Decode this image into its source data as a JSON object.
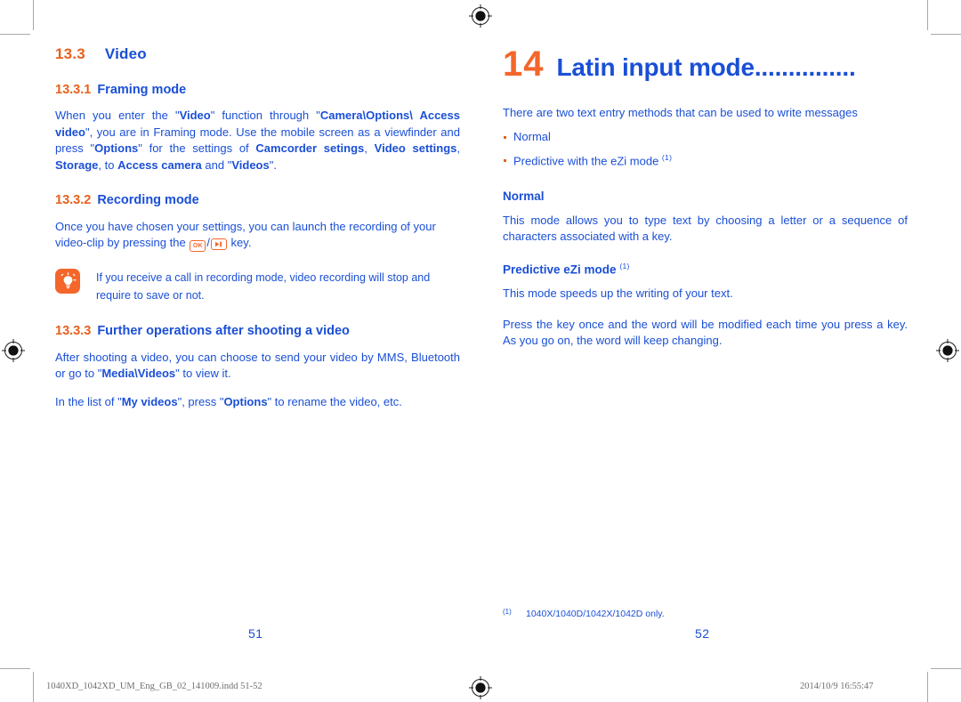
{
  "document": {
    "left_page": {
      "section": {
        "number": "13.3",
        "title": "Video"
      },
      "subsections": [
        {
          "number": "13.3.1",
          "title": "Framing mode",
          "paragraphs": [
            "When you enter the \"Video\" function through \"Camera\\Options\\ Access video\", you are in Framing mode. Use the mobile screen as a viewfinder and press \"Options\" for the settings of Camcorder setings, Video settings, Storage, to Access camera and \"Videos\"."
          ]
        },
        {
          "number": "13.3.2",
          "title": "Recording mode",
          "paragraphs": [
            "Once you have chosen your settings, you can launch the recording of your video-clip by pressing the / key."
          ],
          "tip": "If you receive a call in recording mode, video recording will stop and require to save or not.",
          "keys": {
            "ok_label": "OK",
            "separator": "/"
          }
        },
        {
          "number": "13.3.3",
          "title": "Further operations after shooting a video",
          "paragraphs": [
            "After shooting a video, you can choose to send your video by MMS, Bluetooth or go to \"Media\\Videos\" to view it.",
            "In the list of \"My videos\", press \"Options\" to rename the video, etc."
          ]
        }
      ],
      "folio": "51"
    },
    "right_page": {
      "chapter": {
        "number": "14",
        "title": "Latin input mode..............."
      },
      "intro": "There are two text entry methods that can be used to write messages",
      "bullets": [
        {
          "text": "Normal",
          "footnote": ""
        },
        {
          "text": "Predictive with the eZi mode",
          "footnote": "(1)"
        }
      ],
      "blocks": [
        {
          "heading": "Normal",
          "heading_footnote": "",
          "paragraphs": [
            "This mode allows you to type text by choosing a letter or a sequence of characters associated with a key."
          ]
        },
        {
          "heading": "Predictive eZi mode",
          "heading_footnote": "(1)",
          "paragraphs": [
            "This mode speeds up the writing of your text.",
            "Press the key once and the word will be modified each time you press a key.  As you go on, the word will keep changing."
          ]
        }
      ],
      "footnote": {
        "mark": "(1)",
        "text": "1040X/1040D/1042X/1042D only."
      },
      "folio": "52"
    },
    "print_footer": {
      "file": "1040XD_1042XD_UM_Eng_GB_02_141009.indd   51-52",
      "timestamp": "2014/10/9   16:55:47"
    },
    "colors": {
      "orange": "#E8601C",
      "orange_bright": "#F4662A",
      "blue": "#1A4FD6",
      "crop_gray": "#a8a8a8",
      "footer_gray": "#6e6e6e"
    },
    "marks": {
      "registration": "registration-target",
      "crop": "crop-mark"
    }
  }
}
